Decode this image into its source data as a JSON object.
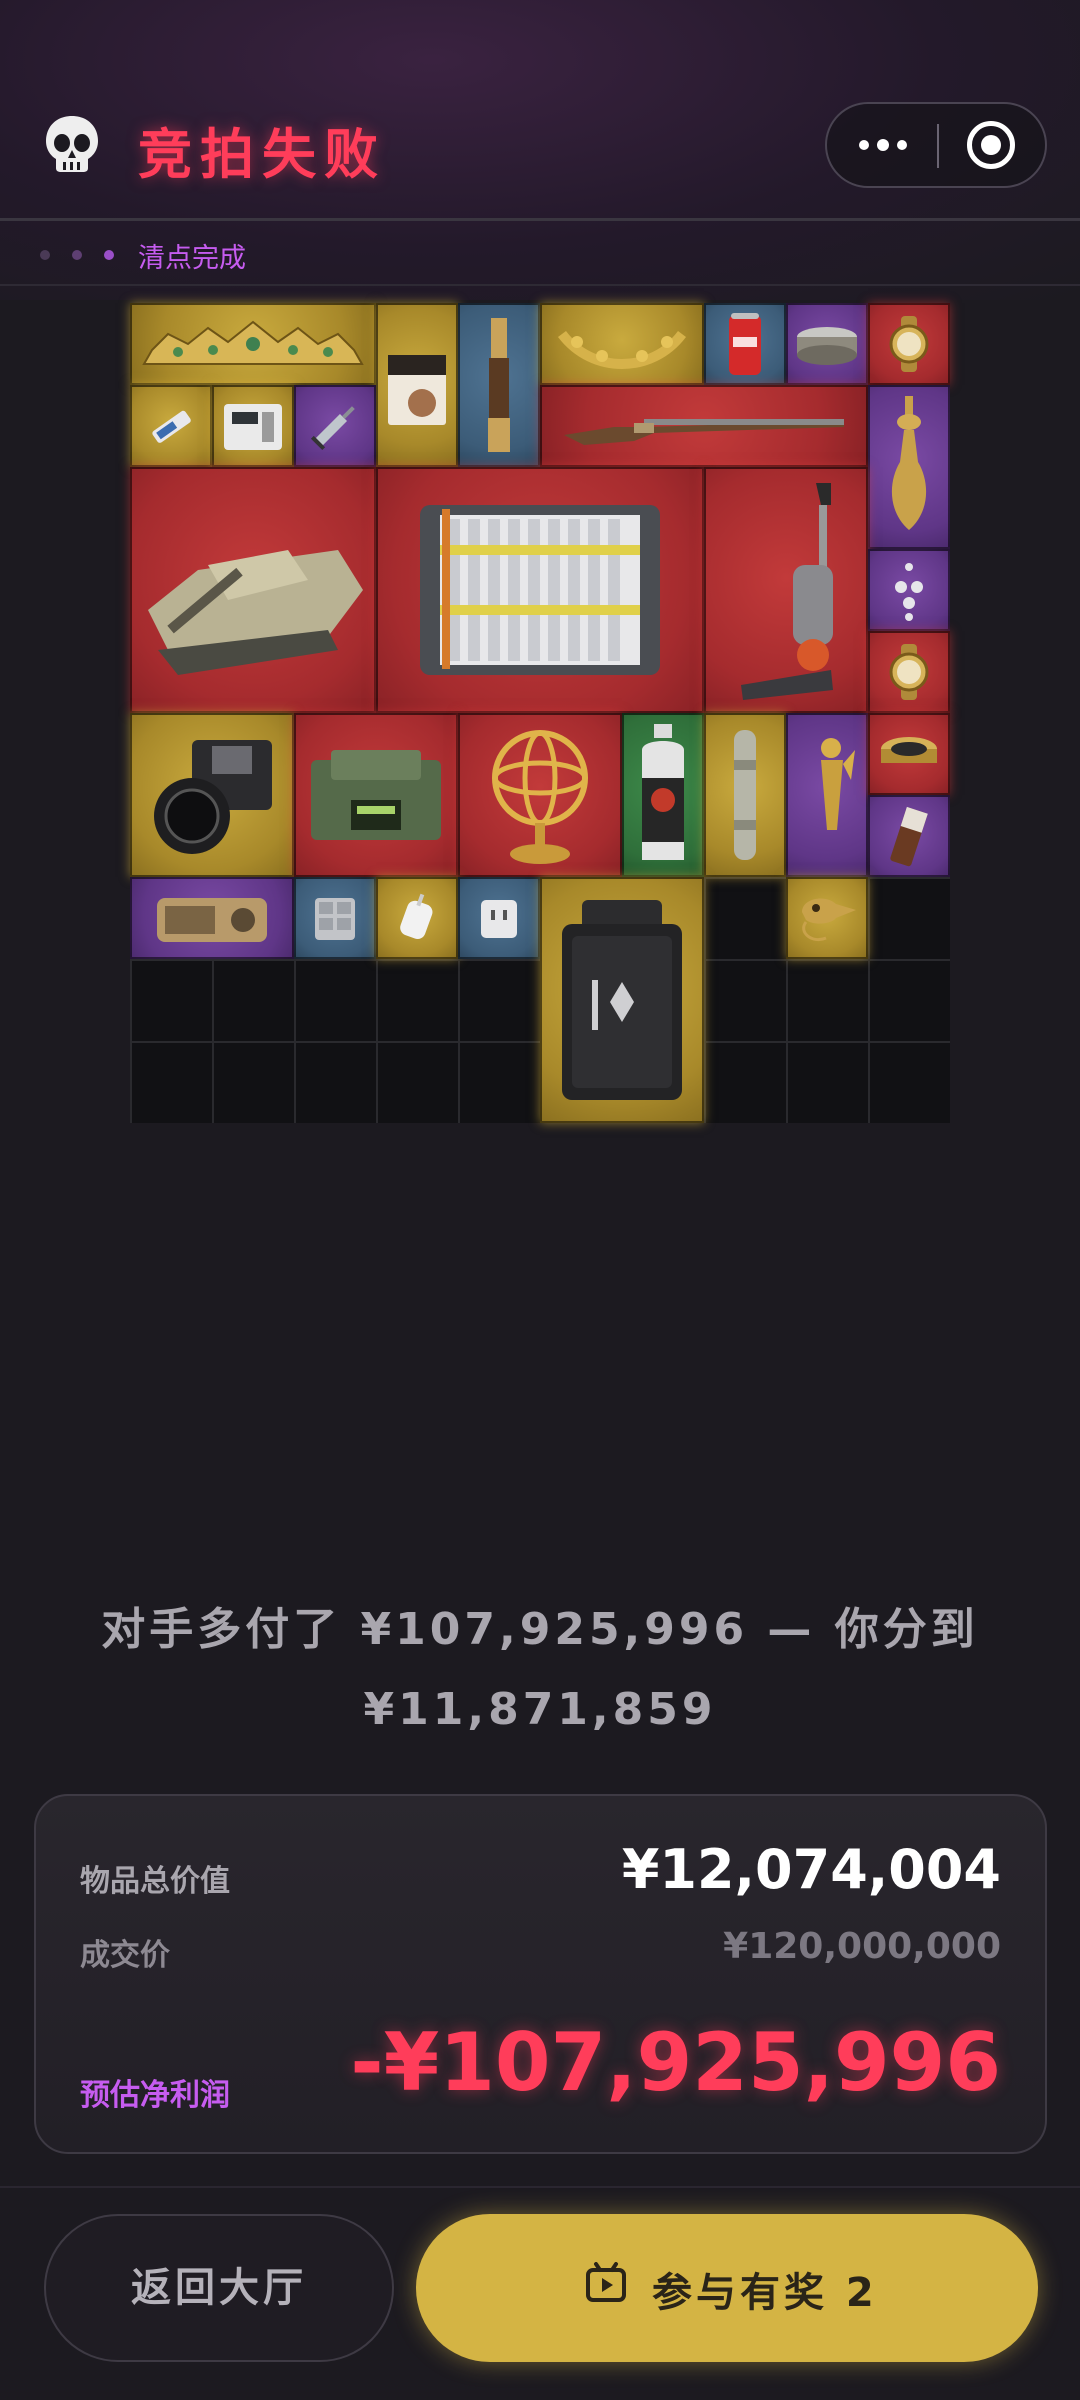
{
  "header": {
    "title": "竞拍失败",
    "status_text": "清点完成"
  },
  "summary": {
    "line1": "对手多付了 ¥107,925,996 — 你分到",
    "line2": "¥11,871,859"
  },
  "card": {
    "total_label": "物品总价值",
    "total_value": "¥12,074,004",
    "price_label": "成交价",
    "price_value": "¥120,000,000",
    "profit_label": "预估净利润",
    "profit_value": "-¥107,925,996"
  },
  "buttons": {
    "back_label": "返回大厅",
    "join_label": "参与有奖 2"
  },
  "colors": {
    "accent_red": "#ff3d5a",
    "accent_purple": "#c65cf0",
    "accent_gold": "#d4b444",
    "rarity_gold": "#b8982e",
    "rarity_red": "#a52b2e",
    "rarity_purple": "#5f3687",
    "rarity_blue": "#3c5c78",
    "rarity_green": "#2f6f3a"
  },
  "grid": {
    "columns": 10,
    "rows": 10,
    "items": [
      {
        "name": "tiara",
        "rarity": "gold"
      },
      {
        "name": "barista-box",
        "rarity": "gold"
      },
      {
        "name": "spyglass",
        "rarity": "blue"
      },
      {
        "name": "laurel-crown",
        "rarity": "gold"
      },
      {
        "name": "soda-can",
        "rarity": "blue"
      },
      {
        "name": "tin-can",
        "rarity": "purple"
      },
      {
        "name": "gold-watch",
        "rarity": "red"
      },
      {
        "name": "usb-stick",
        "rarity": "gold"
      },
      {
        "name": "power-meter",
        "rarity": "gold"
      },
      {
        "name": "syringe",
        "rarity": "purple"
      },
      {
        "name": "antique-rifle",
        "rarity": "red"
      },
      {
        "name": "ornate-vase",
        "rarity": "purple"
      },
      {
        "name": "tank",
        "rarity": "red"
      },
      {
        "name": "battery-pack",
        "rarity": "red"
      },
      {
        "name": "vacuum-cleaner",
        "rarity": "red"
      },
      {
        "name": "earring",
        "rarity": "purple"
      },
      {
        "name": "gold-watch-2",
        "rarity": "red"
      },
      {
        "name": "camera",
        "rarity": "gold"
      },
      {
        "name": "military-radio",
        "rarity": "red"
      },
      {
        "name": "armillary-sphere",
        "rarity": "red"
      },
      {
        "name": "spray-can",
        "rarity": "green"
      },
      {
        "name": "scope-tube",
        "rarity": "gold"
      },
      {
        "name": "golden-statue",
        "rarity": "purple"
      },
      {
        "name": "caviar-tin",
        "rarity": "red"
      },
      {
        "name": "chocolate-bar",
        "rarity": "purple"
      },
      {
        "name": "vintage-radio",
        "rarity": "purple"
      },
      {
        "name": "cube-device",
        "rarity": "blue"
      },
      {
        "name": "white-charger",
        "rarity": "gold"
      },
      {
        "name": "power-adapter",
        "rarity": "blue"
      },
      {
        "name": "power-case",
        "rarity": "gold"
      },
      {
        "name": "bird-skull",
        "rarity": "gold"
      }
    ]
  }
}
